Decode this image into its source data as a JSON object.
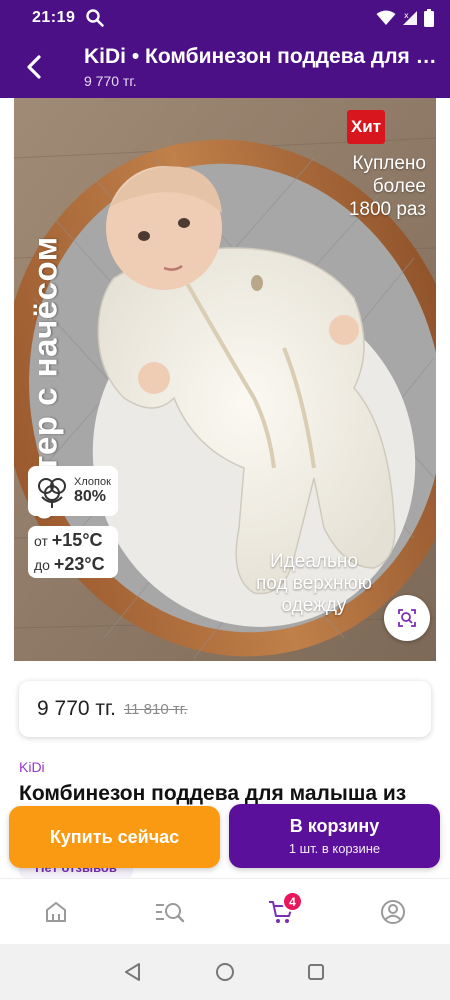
{
  "status_bar": {
    "time": "21:19",
    "icons": [
      "search-icon",
      "wifi-icon",
      "signal-icon",
      "battery-icon"
    ]
  },
  "app_bar": {
    "title": "KiDi • Комбинезон поддева для малыша",
    "subtitle": "9 770 тг.",
    "back_icon": "back-arrow-icon"
  },
  "product_image": {
    "vertical_text": "Футер с начёсом",
    "hit_badge": "Хит",
    "bought_text": [
      "Куплено",
      "более",
      "1800 раз"
    ],
    "cotton": {
      "label": "Хлопок",
      "value": "80%"
    },
    "temperature": [
      {
        "prefix": "от",
        "value": "+15°C"
      },
      {
        "prefix": "до",
        "value": "+23°C"
      }
    ],
    "ideal_text": [
      "Идеально",
      "под верхнюю",
      "одежду"
    ],
    "visual_search_icon": "visual-search-icon"
  },
  "price": {
    "current": "9 770 тг.",
    "old": "11 810 тг."
  },
  "product": {
    "brand": "KiDi",
    "title": "Комбинезон поддева для малыша из",
    "reviews": "Нет отзывов"
  },
  "actions": {
    "buy_now": "Купить сейчас",
    "to_cart": "В корзину",
    "in_cart": "1 шт. в корзине"
  },
  "bottom_nav": {
    "items": [
      "home-icon",
      "catalog-search-icon",
      "cart-icon",
      "profile-icon"
    ],
    "cart_badge": "4"
  },
  "colors": {
    "brand_purple": "#4b0f86",
    "buy_orange": "#f99a12",
    "cart_purple": "#5b109c",
    "hit_red": "#d7161d",
    "badge_pink": "#e9165c"
  }
}
